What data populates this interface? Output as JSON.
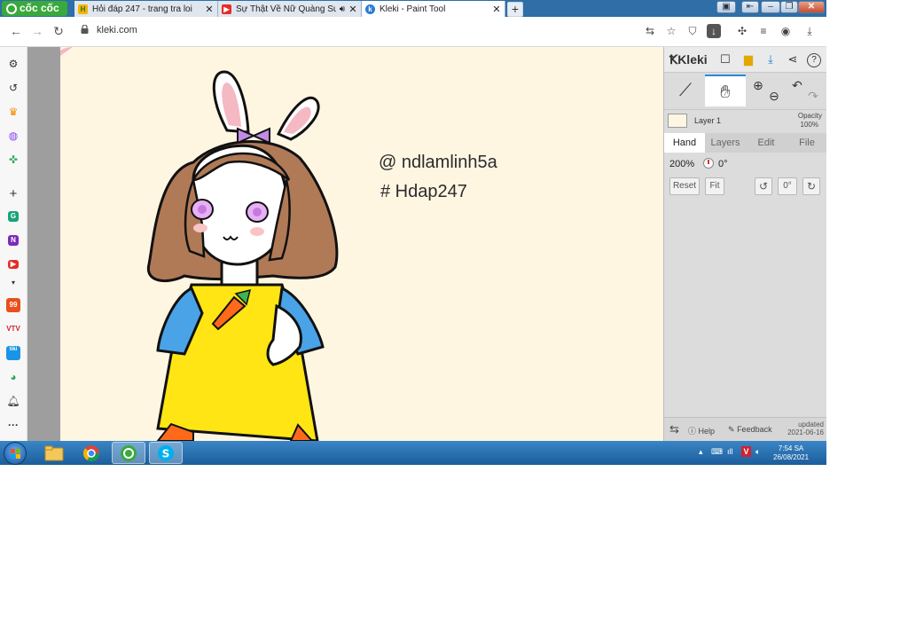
{
  "browser": {
    "brand": "cốc cốc",
    "tabs": [
      {
        "title": "Hỏi đáp 247 - trang tra loi",
        "favicon": "hoidap-icon",
        "active": false
      },
      {
        "title": "Sự Thật Về Nữ Quàng Su",
        "favicon": "youtube-icon",
        "audio": true,
        "active": false
      },
      {
        "title": "Kleki - Paint Tool",
        "favicon": "kleki-icon",
        "active": true
      }
    ],
    "new_tab": "+",
    "url": "kleki.com"
  },
  "canvas": {
    "text_lines": [
      "@ ndlamlinh5a",
      "# Hdap247"
    ],
    "paper_color": "#fff6e2"
  },
  "kleki": {
    "logo": "Kleki",
    "layer": {
      "name": "Layer 1",
      "opacity_label": "Opacity",
      "opacity_value": "100%"
    },
    "tabs": [
      "Hand",
      "Layers",
      "Edit",
      "File"
    ],
    "active_tab": "Hand",
    "zoom": "200%",
    "rotation": "0°",
    "buttons": {
      "reset": "Reset",
      "fit": "Fit",
      "angle": "0°"
    },
    "footer": {
      "help": "Help",
      "feedback": "Feedback",
      "updated_label": "updated",
      "updated_date": "2021-06-16"
    }
  },
  "taskbar": {
    "time": "7:54 SA",
    "date": "26/08/2021"
  }
}
